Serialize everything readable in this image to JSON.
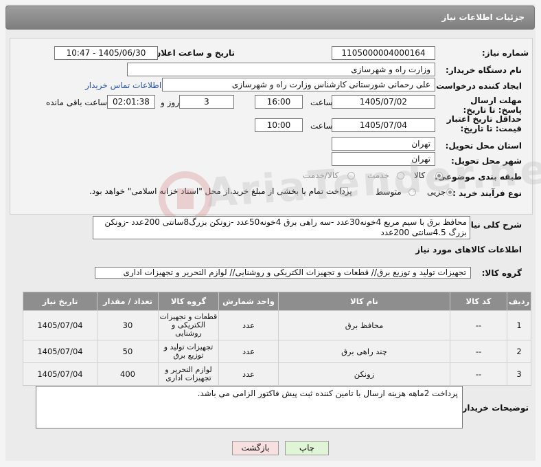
{
  "header": {
    "title": "جزئیات اطلاعات نیاز"
  },
  "fields": {
    "need_number": {
      "label": "شماره نیاز:",
      "value": "1105000004000164"
    },
    "announce_datetime": {
      "label": "تاریخ و ساعت اعلان عمومی:",
      "value": "1405/06/30 - 10:47"
    },
    "buyer_org": {
      "label": "نام دستگاه خریدار:",
      "value": "وزارت راه و شهرسازی"
    },
    "requester": {
      "label": "ایجاد کننده درخواست:",
      "value": "علی رحمانی شورستانی کارشناس وزارت راه و شهرسازی",
      "contact_link": "اطلاعات تماس خریدار"
    },
    "reply_deadline": {
      "label": "مهلت ارسال پاسخ: تا تاریخ:",
      "date": "1405/07/02",
      "time_label": "ساعت",
      "time": "16:00",
      "days": "3",
      "days_label": "روز و",
      "remaining": "02:01:38",
      "remaining_label": "ساعت باقی مانده"
    },
    "price_validity": {
      "label": "حداقل تاریخ اعتبار قیمت: تا تاریخ:",
      "date": "1405/07/04",
      "time_label": "ساعت",
      "time": "10:00"
    },
    "delivery_province": {
      "label": "استان محل تحویل:",
      "value": "تهران"
    },
    "delivery_city": {
      "label": "شهر محل تحویل:",
      "value": "تهران"
    },
    "category": {
      "label": "طبقه بندی موضوعی:",
      "options": [
        "کالا",
        "خدمت",
        "کالا/خدمت"
      ],
      "selected": "کالا"
    },
    "purchase_type": {
      "label": "نوع فرآیند خرید :",
      "options": [
        "جزیی",
        "متوسط"
      ],
      "selected": "جزیی",
      "payment_note": "پرداخت تمام یا بخشی از مبلغ خرید،از محل \"اسناد خزانه اسلامی\" خواهد بود."
    },
    "description": {
      "label": "شرح کلی نیاز:",
      "value": "محافظ برق با سیم مربع 4خونه30عدد -سه راهی برق 4خونه50عدد -زونکن بزرگ8سانتی 200عدد -زونکن بزرگ 4.5سانتی 200عدد"
    }
  },
  "goods_section": {
    "title": "اطلاعات کالاهای مورد نیاز"
  },
  "goods_group": {
    "label": "گروه کالا:",
    "value": "تجهیزات تولید و توزیع برق// قطعات و تجهیزات الکتریکی و روشنایی// لوازم التحریر و تجهیزات اداری"
  },
  "table": {
    "headers": [
      "ردیف",
      "کد کالا",
      "نام کالا",
      "واحد شمارش",
      "گروه کالا",
      "تعداد / مقدار",
      "تاریخ نیاز"
    ],
    "rows": [
      {
        "index": "1",
        "code": "--",
        "name": "محافظ برق",
        "unit": "عدد",
        "group": "قطعات و تجهیزات الکتریکی و روشنایی",
        "qty": "30",
        "date": "1405/07/04"
      },
      {
        "index": "2",
        "code": "--",
        "name": "چند راهی برق",
        "unit": "عدد",
        "group": "تجهیزات تولید و توزیع برق",
        "qty": "50",
        "date": "1405/07/04"
      },
      {
        "index": "3",
        "code": "--",
        "name": "زونکن",
        "unit": "عدد",
        "group": "لوازم التحریر و تجهیزات اداری",
        "qty": "400",
        "date": "1405/07/04"
      }
    ]
  },
  "buyer_notes": {
    "label": "توضیحات خریدار:",
    "value": "پرداخت 2ماهه هزینه ارسال با تامین کننده ثبت پیش فاکتور الزامی می باشد."
  },
  "buttons": {
    "print": "چاپ",
    "back": "بازگشت"
  },
  "watermark": "AriaTender.net"
}
